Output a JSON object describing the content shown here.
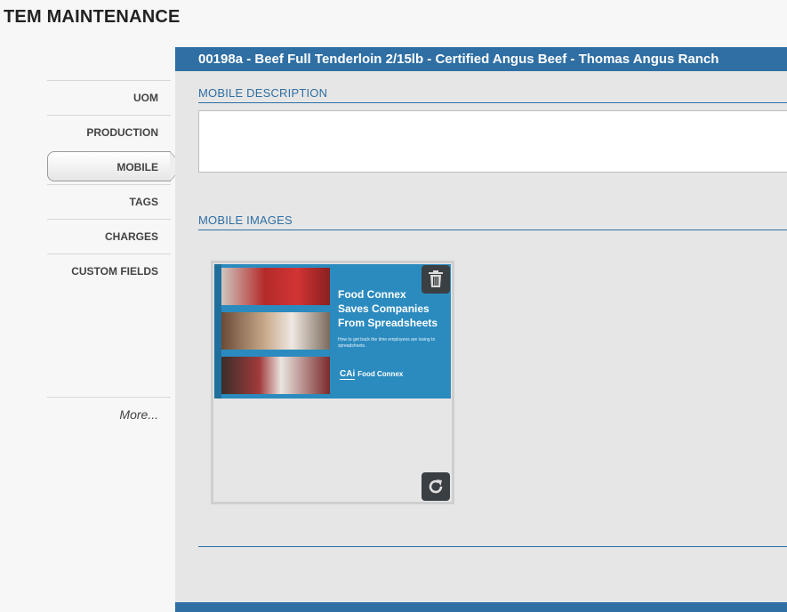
{
  "page": {
    "title": "TEM MAINTENANCE"
  },
  "sidebar": {
    "items": [
      {
        "label": "UOM",
        "active": false
      },
      {
        "label": "PRODUCTION",
        "active": false
      },
      {
        "label": "MOBILE",
        "active": true
      },
      {
        "label": "TAGS",
        "active": false
      },
      {
        "label": "CHARGES",
        "active": false
      },
      {
        "label": "CUSTOM FIELDS",
        "active": false
      }
    ],
    "more_label": "More..."
  },
  "main": {
    "header": "00198a - Beef Full Tenderloin 2/15lb - Certified Angus Beef - Thomas Angus Ranch",
    "mobile_description_label": "MOBILE DESCRIPTION",
    "mobile_description_value": "",
    "mobile_images_label": "MOBILE IMAGES",
    "image": {
      "title_line1": "Food Connex",
      "title_line2": "Saves Companies",
      "title_line3": "From Spreadsheets",
      "subtitle": "How to get back the time employees are losing to spreadsheets.",
      "logo_mark": "CAi",
      "logo_text": "Food Connex",
      "delete_icon": "trash-icon",
      "rotate_icon": "rotate-icon"
    }
  },
  "colors": {
    "accent": "#2f6fa4",
    "panel_bg": "#e6e6e6",
    "icon_button": "#3a3f44",
    "thumb_bg": "#2b8bbf"
  }
}
